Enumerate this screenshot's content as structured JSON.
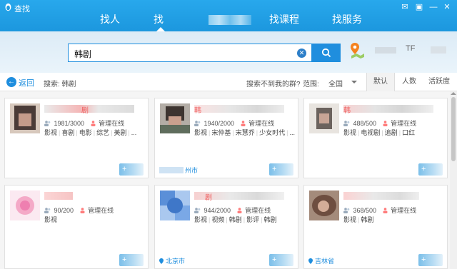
{
  "window": {
    "title": "查找",
    "buttons": [
      "skin-icon",
      "menu-icon",
      "minimize-icon",
      "close-icon"
    ]
  },
  "tabs": [
    {
      "label": "找人",
      "active": false
    },
    {
      "label": "找",
      "active": true
    },
    {
      "label": "",
      "active": false
    },
    {
      "label": "找课程",
      "active": false
    },
    {
      "label": "找服务",
      "active": false
    }
  ],
  "search": {
    "value": "韩剧",
    "user_text": "TF"
  },
  "filterbar": {
    "back_label": "返回",
    "search_label": "搜索: 韩剧",
    "nofind_label": "搜索不到我的群?",
    "range_label": "范围:",
    "range_value": "全国",
    "sort_options": [
      "默认",
      "人数",
      "活跃度"
    ],
    "sort_active": "默认"
  },
  "cards": [
    {
      "name_prefix": "",
      "name_mid": "剧",
      "count": "1981/3000",
      "admin": "管理在线",
      "tags": [
        "影视",
        "喜剧",
        "电影",
        "综艺",
        "美剧",
        "..."
      ],
      "location": "",
      "add_label": "+"
    },
    {
      "name_prefix": "韩",
      "name_mid": "",
      "count": "1940/2000",
      "admin": "管理在线",
      "tags": [
        "影视",
        "宋仲基",
        "宋慧乔",
        "少女时代",
        "..."
      ],
      "location": "州市",
      "add_label": "+"
    },
    {
      "name_prefix": "韩",
      "name_mid": "",
      "count": "488/500",
      "admin": "管理在线",
      "tags": [
        "影视",
        "电视剧",
        "追剧",
        "口红"
      ],
      "location": "",
      "add_label": "+"
    },
    {
      "name_prefix": "",
      "name_mid": "",
      "count": "90/200",
      "admin": "管理在线",
      "tags": [
        "影视"
      ],
      "location": "",
      "add_label": "+"
    },
    {
      "name_prefix": "",
      "name_mid": "剧",
      "count": "944/2000",
      "admin": "管理在线",
      "tags": [
        "影视",
        "视频",
        "韩剧",
        "影评",
        "韩剧"
      ],
      "location": "北京市",
      "add_label": "+"
    },
    {
      "name_prefix": "",
      "name_mid": "",
      "count": "368/500",
      "admin": "管理在线",
      "tags": [
        "影视",
        "韩剧"
      ],
      "location": "吉林省",
      "add_label": "+"
    }
  ],
  "colors": {
    "header_blue": "#1f9be0",
    "accent": "#1f8ede",
    "admin_red": "#ff6b6b"
  }
}
